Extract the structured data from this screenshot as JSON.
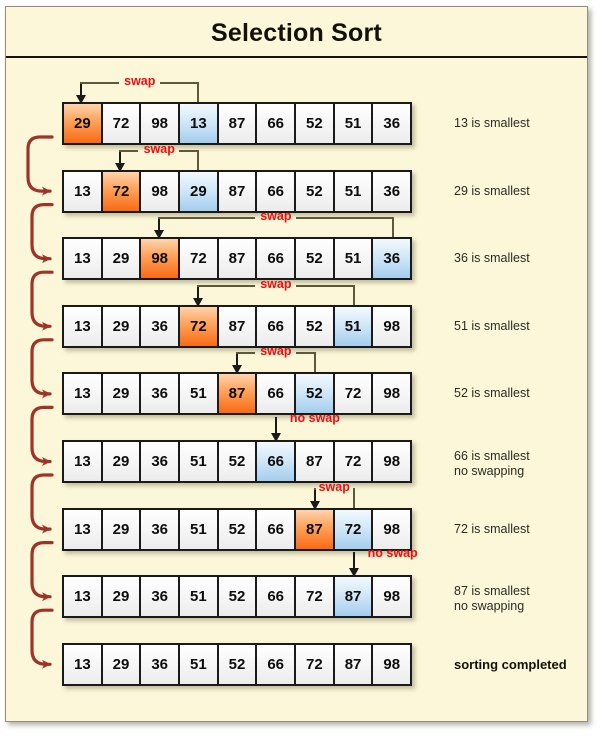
{
  "title": "Selection  Sort",
  "colors": {
    "background": "#fbf7d8",
    "highlight_min": "#a4cdee",
    "highlight_current": "#f86a14",
    "swap_label": "#f40c0c",
    "connector": "#9e3428",
    "bracket": "#5d5a3c"
  },
  "chart_data": {
    "type": "table",
    "title": "Selection  Sort",
    "columns": 9,
    "steps": [
      {
        "values": [
          29,
          72,
          98,
          13,
          87,
          66,
          52,
          51,
          36
        ],
        "current_index": 0,
        "min_index": 3,
        "marker": "swap",
        "note": "13 is smallest"
      },
      {
        "values": [
          13,
          72,
          98,
          29,
          87,
          66,
          52,
          51,
          36
        ],
        "current_index": 1,
        "min_index": 3,
        "marker": "swap",
        "note": "29 is smallest"
      },
      {
        "values": [
          13,
          29,
          98,
          72,
          87,
          66,
          52,
          51,
          36
        ],
        "current_index": 2,
        "min_index": 8,
        "marker": "swap",
        "note": "36 is smallest"
      },
      {
        "values": [
          13,
          29,
          36,
          72,
          87,
          66,
          52,
          51,
          98
        ],
        "current_index": 3,
        "min_index": 7,
        "marker": "swap",
        "note": "51 is smallest"
      },
      {
        "values": [
          13,
          29,
          36,
          51,
          87,
          66,
          52,
          72,
          98
        ],
        "current_index": 4,
        "min_index": 6,
        "marker": "swap",
        "note": "52 is smallest"
      },
      {
        "values": [
          13,
          29,
          36,
          51,
          52,
          66,
          87,
          72,
          98
        ],
        "current_index": 5,
        "min_index": 5,
        "marker": "no swap",
        "note": "66 is smallest\nno swapping"
      },
      {
        "values": [
          13,
          29,
          36,
          51,
          52,
          66,
          87,
          72,
          98
        ],
        "current_index": 6,
        "min_index": 7,
        "marker": "swap",
        "note": "72 is smallest"
      },
      {
        "values": [
          13,
          29,
          36,
          51,
          52,
          66,
          72,
          87,
          98
        ],
        "current_index": 7,
        "min_index": 7,
        "marker": "no swap",
        "note": "87 is smallest\nno swapping"
      },
      {
        "values": [
          13,
          29,
          36,
          51,
          52,
          66,
          72,
          87,
          98
        ],
        "current_index": -1,
        "min_index": -1,
        "marker": "",
        "note": "sorting completed"
      }
    ]
  }
}
